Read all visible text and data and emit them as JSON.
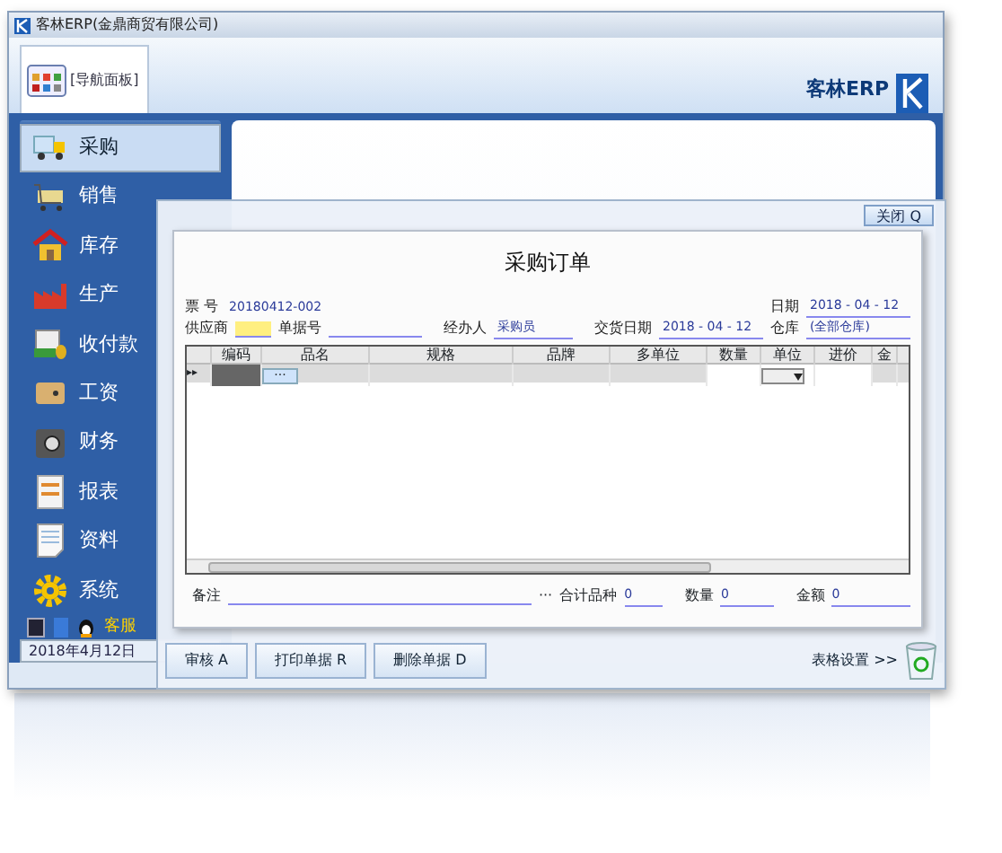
{
  "window": {
    "title": "客林ERP(金鼎商贸有限公司)"
  },
  "nav_tab": {
    "label": "[导航面板]"
  },
  "brand": {
    "text": "客林ERP"
  },
  "sidebar": {
    "items": [
      {
        "label": "采购",
        "kind": "truck",
        "selected": true
      },
      {
        "label": "销售",
        "kind": "cart",
        "selected": false
      },
      {
        "label": "库存",
        "kind": "house",
        "selected": false
      },
      {
        "label": "生产",
        "kind": "factory",
        "selected": false
      },
      {
        "label": "收付款",
        "kind": "money",
        "selected": false
      },
      {
        "label": "工资",
        "kind": "wallet",
        "selected": false
      },
      {
        "label": "财务",
        "kind": "safe",
        "selected": false
      },
      {
        "label": "报表",
        "kind": "report",
        "selected": false
      },
      {
        "label": "资料",
        "kind": "sheet",
        "selected": false
      },
      {
        "label": "系统",
        "kind": "gear",
        "selected": false
      }
    ],
    "support": "客服",
    "date": "2018年4月12日"
  },
  "dialog": {
    "close": "关闭 Q",
    "title": "采购订单",
    "fields": {
      "bill_no_label": "票 号",
      "bill_no": "20180412-002",
      "date_label": "日期",
      "date": "2018 - 04 - 12",
      "supplier_label": "供应商",
      "doc_no_label": "单据号",
      "handler_label": "经办人",
      "handler": "采购员",
      "delivery_label": "交货日期",
      "delivery": "2018 - 04 - 12",
      "warehouse_label": "仓库",
      "warehouse": "(全部仓库)"
    },
    "table": {
      "columns": [
        "编码",
        "品名",
        "规格",
        "品牌",
        "多单位",
        "数量",
        "单位",
        "进价",
        "金"
      ],
      "row_marker": "▸▸",
      "ellipsis": "···"
    },
    "footer": {
      "remark_label": "备注",
      "remark_more": "···",
      "total_kinds_label": "合计品种",
      "total_kinds": "0",
      "qty_label": "数量",
      "qty": "0",
      "amount_label": "金额",
      "amount": "0"
    }
  },
  "buttons": [
    "审核 A",
    "打印单据 R",
    "删除单据 D"
  ],
  "table_settings": "表格设置 >>"
}
